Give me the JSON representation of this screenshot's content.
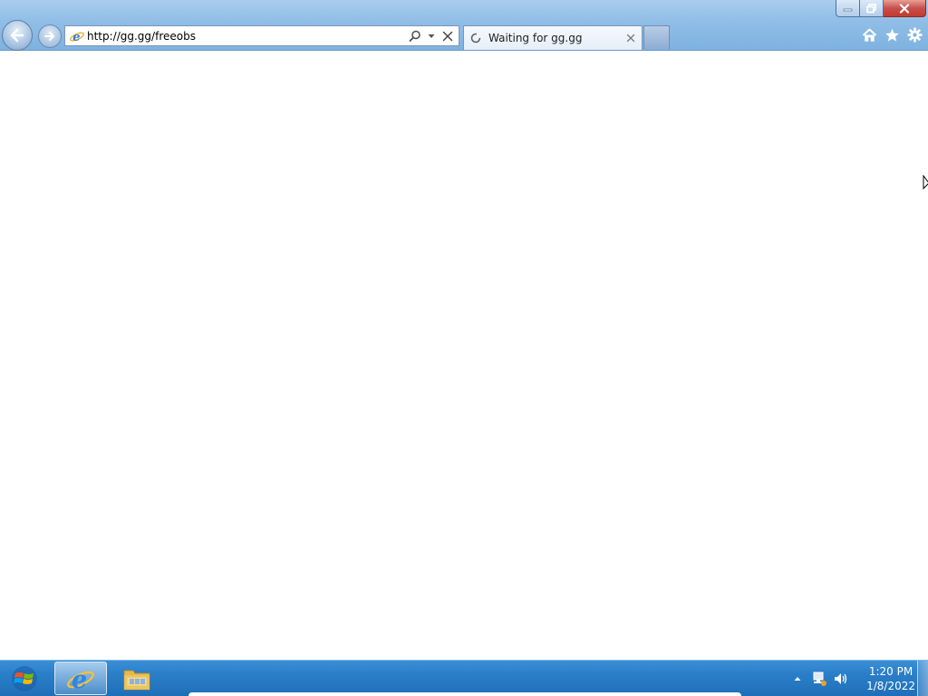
{
  "browser": {
    "address": {
      "url": "http://gg.gg/freeobs"
    },
    "tab": {
      "title": "Waiting for gg.gg"
    },
    "window_controls": {
      "minimize": "minimize-icon",
      "maximize": "restore-icon",
      "close": "close-icon"
    },
    "commands": [
      "home-icon",
      "favorites-star-icon",
      "tools-gear-icon"
    ]
  },
  "taskbar": {
    "apps": [
      {
        "name": "Internet Explorer",
        "icon": "ie-icon",
        "active": true
      },
      {
        "name": "Windows Explorer",
        "icon": "folder-icon",
        "active": false
      }
    ],
    "clock": {
      "time": "1:20 PM",
      "date": "1/8/2022"
    }
  },
  "colors": {
    "frame": "#8fbde6",
    "taskbar": "#2a7ec8",
    "close_button": "#c75050",
    "page_background": "#ffffff"
  }
}
